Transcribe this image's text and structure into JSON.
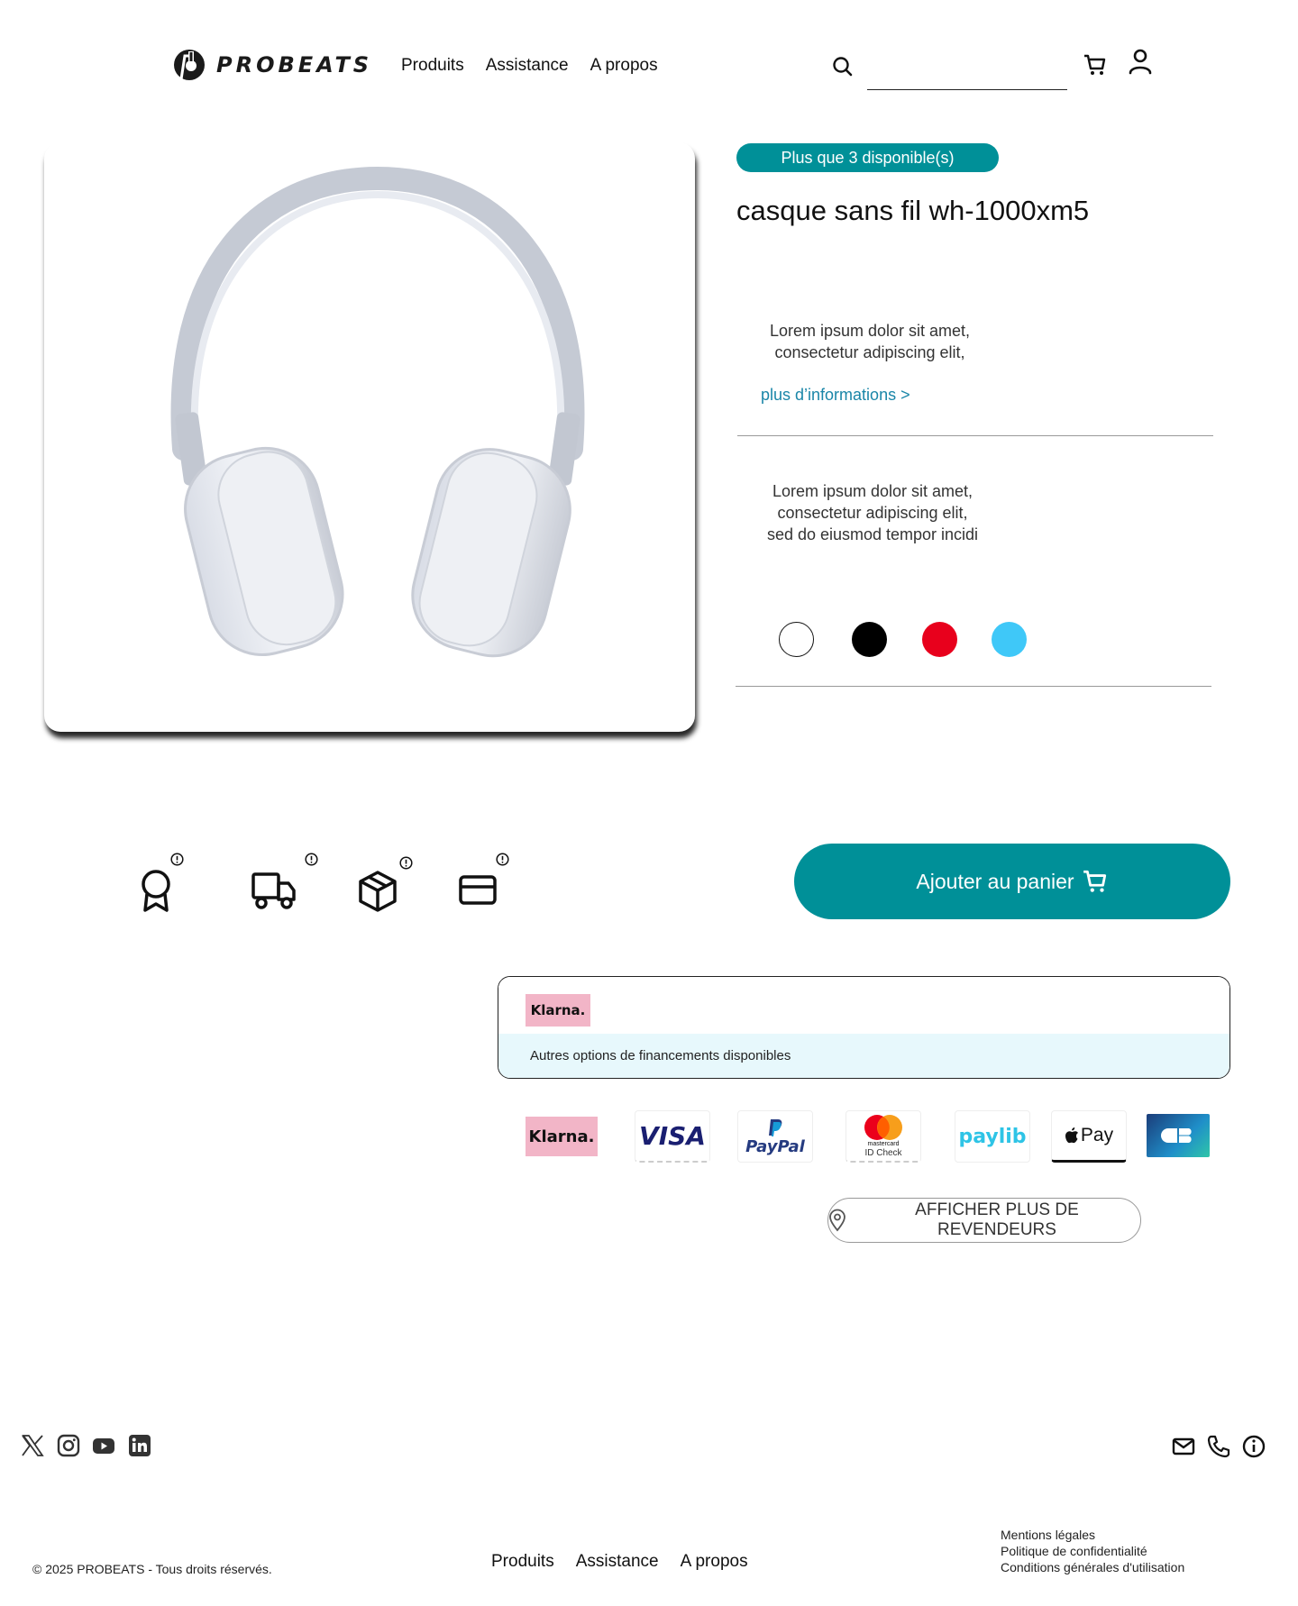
{
  "header": {
    "brand": "PROBEATS",
    "nav": [
      "Produits",
      "Assistance",
      "A propos"
    ],
    "search_placeholder": ""
  },
  "product": {
    "stock_badge": "Plus que 3 disponible(s)",
    "title": "casque sans fil wh-1000xm5",
    "description1_line1": "Lorem ipsum dolor sit amet,",
    "description1_line2": "consectetur adipiscing elit,",
    "more_info": "plus d’informations >",
    "description2_line1": "Lorem ipsum dolor sit amet,",
    "description2_line2": "consectetur adipiscing elit,",
    "description2_line3": "sed do eiusmod tempor incidi",
    "colors": [
      "#ffffff",
      "#000000",
      "#e8001c",
      "#3fc8f8"
    ],
    "add_to_cart": "Ajouter au panier"
  },
  "features": [
    "award-icon",
    "truck-icon",
    "box-icon",
    "card-icon"
  ],
  "financing": {
    "klarna_label": "Klarna.",
    "options_text": "Autres options  de financements disponibles"
  },
  "payments": {
    "klarna": "Klarna.",
    "visa": "VISA",
    "paypal": "PayPal",
    "mastercard_line1": "mastercard",
    "mastercard_line2": "ID Check",
    "paylib": "paylib",
    "applepay": "Pay"
  },
  "resellers_button": "AFFICHER PLUS DE REVENDEURS",
  "footer": {
    "copyright": "© 2025 PROBEATS - Tous droits réservés.",
    "nav": [
      "Produits",
      "Assistance",
      "A propos"
    ],
    "legal": [
      "Mentions légales",
      "Politique de confidentialité",
      "Conditions générales d'utilisation"
    ]
  },
  "accent_color": "#009098",
  "link_color": "#1a86a8"
}
